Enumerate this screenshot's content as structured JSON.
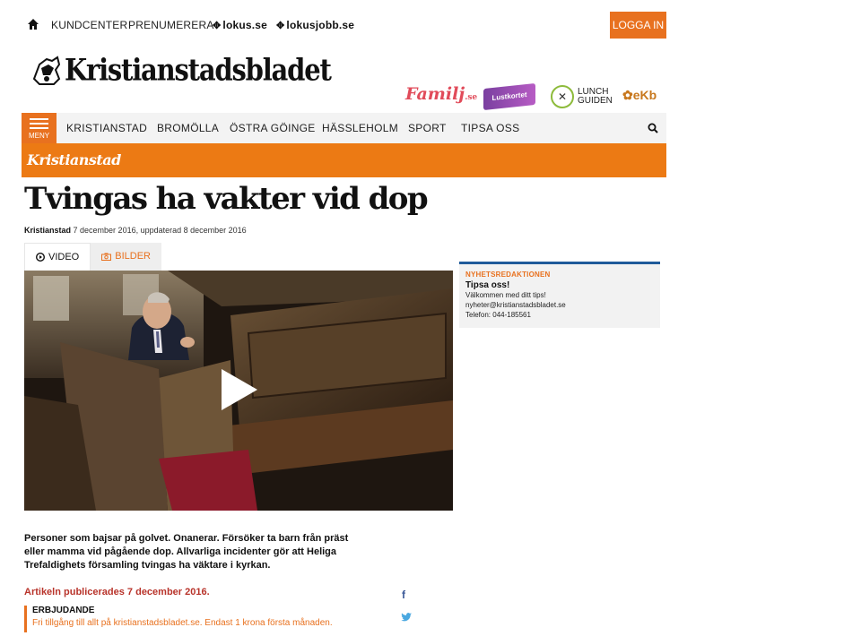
{
  "topbar": {
    "links": [
      "KUNDCENTER",
      "PRENUMERERA"
    ],
    "brands": [
      "lokus.se",
      "lokusjobb.se"
    ],
    "login_label": "LOGGA IN"
  },
  "logo": {
    "name": "Kristianstadsbladet"
  },
  "partners": {
    "familj": "Familj",
    "familj_suffix": ".se",
    "lust": "Lustkortet",
    "lunch_line1": "LUNCH",
    "lunch_line2": "GUIDEN",
    "ekb": "eKb"
  },
  "nav": {
    "menu_label": "MENY",
    "items": [
      "KRISTIANSTAD",
      "BROMÖLLA",
      "ÖSTRA GÖINGE",
      "HÄSSLEHOLM",
      "SPORT",
      "TIPSA OSS"
    ]
  },
  "section": {
    "title": "Kristianstad"
  },
  "article": {
    "headline": "Tvingas ha vakter vid dop",
    "location": "Kristianstad",
    "dates": "7 december 2016, uppdaterad 8 december 2016",
    "lead": "Personer som bajsar på golvet. Onanerar. Försöker ta barn från präst eller mamma vid pågående dop. Allvarliga incidenter gör att Heliga Trefaldighets församling tvingas ha väktare i kyrkan.",
    "published": "Artikeln publicerades 7 december 2016."
  },
  "media_tabs": {
    "video": "VIDEO",
    "images": "BILDER"
  },
  "tips_box": {
    "kicker": "NYHETSREDAKTIONEN",
    "heading": "Tipsa oss!",
    "line1": "Välkommen med ditt tips!",
    "email": "nyheter@kristianstadsbladet.se",
    "phone": "Telefon: 044-185561"
  },
  "offer": {
    "heading": "ERBJUDANDE",
    "text": "Fri tillgång till allt på kristianstadsbladet.se. Endast 1 krona första månaden."
  },
  "colors": {
    "accent": "#e8711f",
    "tips_border": "#1f5a9a",
    "published": "#b8332a"
  },
  "icons": [
    "home-icon",
    "search-icon",
    "play-icon",
    "facebook-icon",
    "twitter-icon",
    "video-icon",
    "camera-icon"
  ]
}
